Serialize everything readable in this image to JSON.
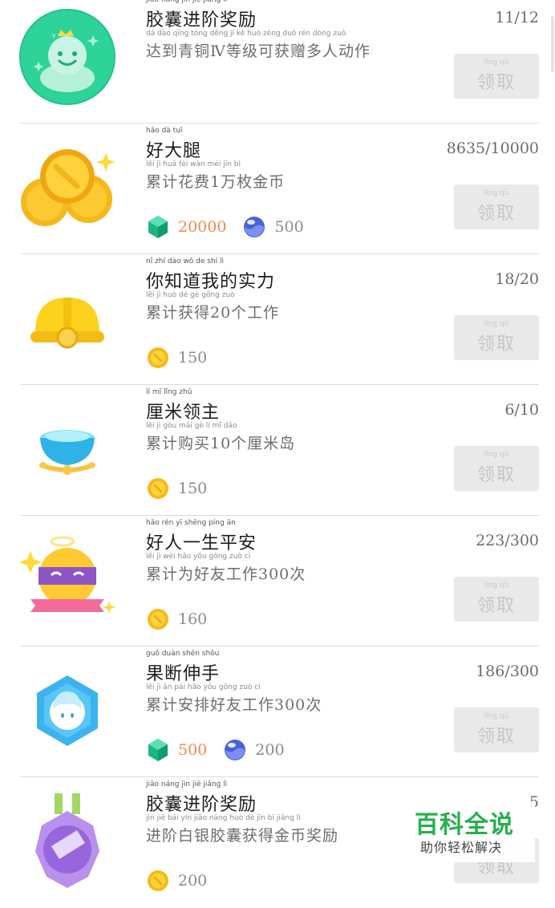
{
  "achievements": [
    {
      "title": "胶囊进阶奖励",
      "title_pinyin": "jiāo náng jìn jiē jiǎng lì",
      "description": "达到青铜Ⅳ等级可获赠多人动作",
      "description_pinyin": "dá dào qīng tóng děng jí kě huò zèng duō rén dòng zuò",
      "progress": "11/12",
      "button_label": "领取",
      "button_pinyin": "lǐng qǔ",
      "icon": "green-capsule-icon",
      "rewards": []
    },
    {
      "title": "好大腿",
      "title_pinyin": "hǎo dà tuǐ",
      "description": "累计花费1万枚金币",
      "description_pinyin": "lěi jì huā fèi wàn méi jīn bì",
      "progress": "8635/10000",
      "button_label": "领取",
      "button_pinyin": "lǐng qǔ",
      "icon": "gold-coins-icon",
      "rewards": [
        {
          "icon": "green-gem-icon",
          "amount": "20000",
          "highlight": true
        },
        {
          "icon": "blue-potion-icon",
          "amount": "500",
          "highlight": false
        }
      ]
    },
    {
      "title": "你知道我的实力",
      "title_pinyin": "nǐ zhī dào wǒ de shí lì",
      "description": "累计获得20个工作",
      "description_pinyin": "lěi jì huò dé gè gōng zuò",
      "progress": "18/20",
      "button_label": "领取",
      "button_pinyin": "lǐng qǔ",
      "icon": "hard-hat-icon",
      "rewards": [
        {
          "icon": "coin-icon",
          "amount": "150",
          "highlight": false
        }
      ]
    },
    {
      "title": "厘米领主",
      "title_pinyin": "lí mǐ lǐng zhǔ",
      "description": "累计购买10个厘米岛",
      "description_pinyin": "lěi jì gòu mǎi gè lí mǐ dǎo",
      "progress": "6/10",
      "button_label": "领取",
      "button_pinyin": "lǐng qǔ",
      "icon": "blue-island-icon",
      "rewards": [
        {
          "icon": "coin-icon",
          "amount": "150",
          "highlight": false
        }
      ]
    },
    {
      "title": "好人一生平安",
      "title_pinyin": "hǎo rén yī shēng píng ān",
      "description": "累计为好友工作300次",
      "description_pinyin": "lěi jì wèi hǎo yǒu gōng zuò cì",
      "progress": "223/300",
      "button_label": "领取",
      "button_pinyin": "lǐng qǔ",
      "icon": "angel-capsule-icon",
      "rewards": [
        {
          "icon": "coin-icon",
          "amount": "160",
          "highlight": false
        }
      ]
    },
    {
      "title": "果断伸手",
      "title_pinyin": "guǒ duàn shēn shǒu",
      "description": "累计安排好友工作300次",
      "description_pinyin": "lěi jì ān pái hǎo yǒu gōng zuò cì",
      "progress": "186/300",
      "button_label": "领取",
      "button_pinyin": "lǐng qǔ",
      "icon": "blue-hexagon-icon",
      "rewards": [
        {
          "icon": "green-gem-icon",
          "amount": "500",
          "highlight": true
        },
        {
          "icon": "blue-potion-icon",
          "amount": "200",
          "highlight": false
        }
      ]
    },
    {
      "title": "胶囊进阶奖励",
      "title_pinyin": "jiāo náng jìn jiē jiǎng lì",
      "description": "进阶白银胶囊获得金币奖励",
      "description_pinyin": "jìn jiē bái yín jiāo náng huò dé jīn bì jiǎng lì",
      "progress": "5",
      "button_label": "领取",
      "button_pinyin": "lǐng qǔ",
      "icon": "purple-medal-icon",
      "rewards": [
        {
          "icon": "coin-icon",
          "amount": "200",
          "highlight": false
        }
      ]
    }
  ],
  "watermark": {
    "title": "百科全说",
    "subtitle": "助你轻松解决"
  }
}
